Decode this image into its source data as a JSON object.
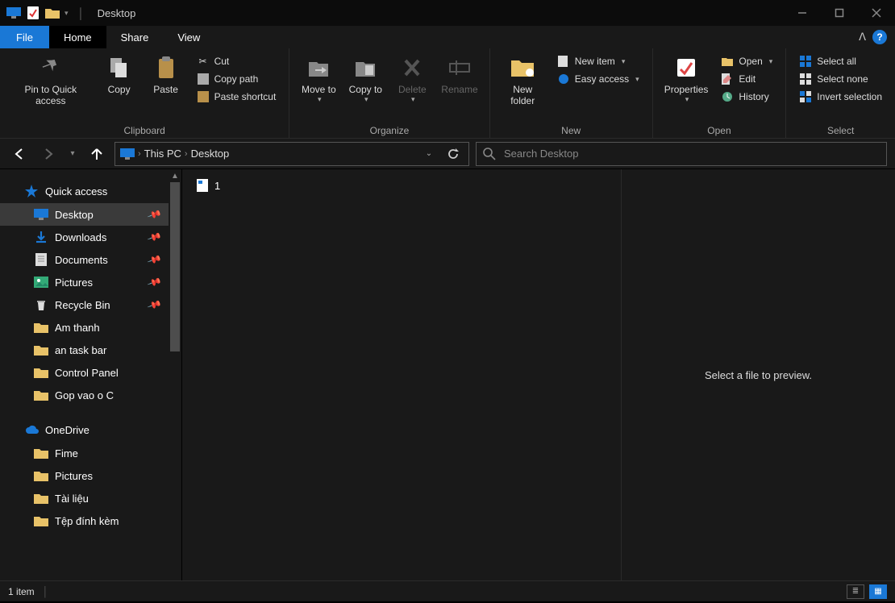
{
  "titlebar": {
    "title": "Desktop"
  },
  "tabs": {
    "file": "File",
    "home": "Home",
    "share": "Share",
    "view": "View"
  },
  "ribbon": {
    "clipboard": {
      "label": "Clipboard",
      "pin": "Pin to Quick access",
      "copy": "Copy",
      "paste": "Paste",
      "cut": "Cut",
      "copy_path": "Copy path",
      "paste_shortcut": "Paste shortcut"
    },
    "organize": {
      "label": "Organize",
      "move_to": "Move to",
      "copy_to": "Copy to",
      "delete": "Delete",
      "rename": "Rename"
    },
    "new": {
      "label": "New",
      "new_folder": "New folder",
      "new_item": "New item",
      "easy_access": "Easy access"
    },
    "open": {
      "label": "Open",
      "properties": "Properties",
      "open": "Open",
      "edit": "Edit",
      "history": "History"
    },
    "select": {
      "label": "Select",
      "select_all": "Select all",
      "select_none": "Select none",
      "invert": "Invert selection"
    }
  },
  "breadcrumb": {
    "root": "This PC",
    "current": "Desktop"
  },
  "search": {
    "placeholder": "Search Desktop"
  },
  "sidebar": {
    "quick_access": "Quick access",
    "items_qa": [
      {
        "label": "Desktop",
        "pinned": true,
        "selected": true,
        "icon": "monitor"
      },
      {
        "label": "Downloads",
        "pinned": true,
        "icon": "download"
      },
      {
        "label": "Documents",
        "pinned": true,
        "icon": "document"
      },
      {
        "label": "Pictures",
        "pinned": true,
        "icon": "pictures"
      },
      {
        "label": "Recycle Bin",
        "pinned": true,
        "icon": "recycle"
      },
      {
        "label": "Am thanh",
        "icon": "folder"
      },
      {
        "label": "an task bar",
        "icon": "folder"
      },
      {
        "label": "Control Panel",
        "icon": "folder"
      },
      {
        "label": "Gop vao o C",
        "icon": "folder"
      }
    ],
    "onedrive": "OneDrive",
    "items_od": [
      {
        "label": "Fime",
        "icon": "folder"
      },
      {
        "label": "Pictures",
        "icon": "folder"
      },
      {
        "label": "Tài liệu",
        "icon": "folder"
      },
      {
        "label": "Tệp đính kèm",
        "icon": "folder"
      }
    ]
  },
  "files": [
    {
      "name": "1"
    }
  ],
  "preview": {
    "empty": "Select a file to preview."
  },
  "status": {
    "count": "1 item"
  }
}
